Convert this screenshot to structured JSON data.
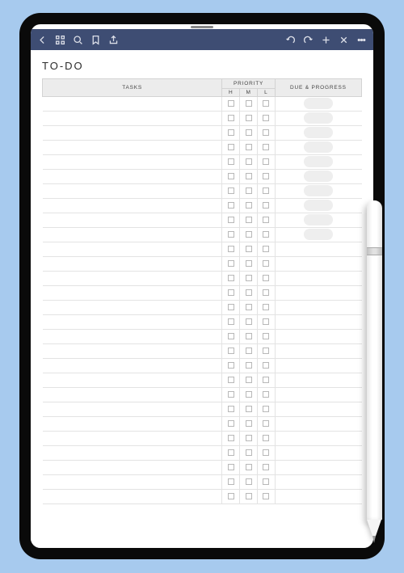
{
  "page": {
    "title": "TO-DO"
  },
  "headers": {
    "tasks": "TASKS",
    "priority": "PRIORITY",
    "h": "H",
    "m": "M",
    "l": "L",
    "due": "DUE & PROGRESS"
  },
  "row_count": 28,
  "pill_row_count": 10,
  "toolbar_icons": {
    "back": "back-icon",
    "grid": "grid-icon",
    "search": "search-icon",
    "bookmark": "bookmark-icon",
    "share": "share-icon",
    "undo": "undo-icon",
    "redo": "redo-icon",
    "add": "add-icon",
    "close": "close-icon",
    "more": "more-icon"
  }
}
